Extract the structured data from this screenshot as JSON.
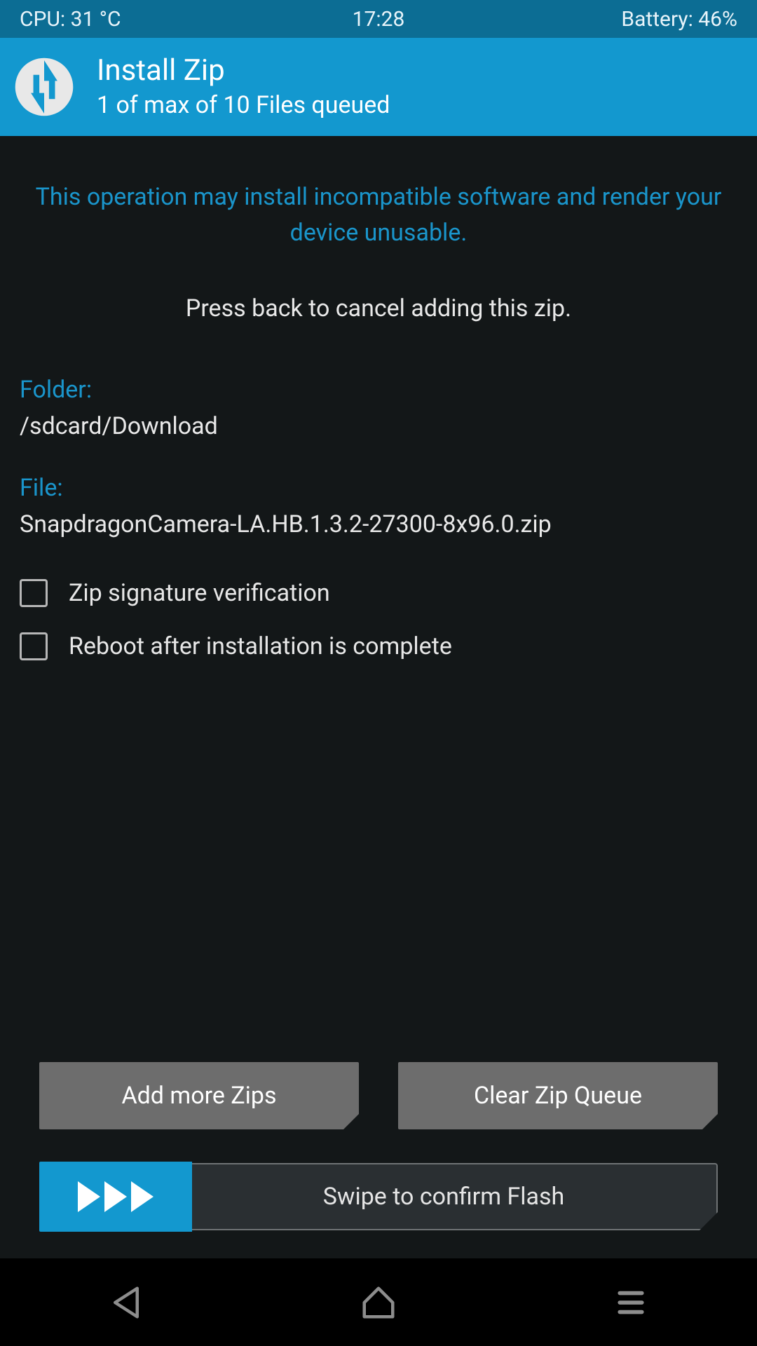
{
  "statusbar": {
    "cpu": "CPU: 31 °C",
    "time": "17:28",
    "battery": "Battery: 46%"
  },
  "header": {
    "title": "Install Zip",
    "subtitle": "1 of max of 10 Files queued"
  },
  "content": {
    "warning": "This operation may install incompatible software and render your device unusable.",
    "instruction": "Press back to cancel adding this zip.",
    "folder_label": "Folder:",
    "folder_value": "/sdcard/Download",
    "file_label": "File:",
    "file_value": "SnapdragonCamera-LA.HB.1.3.2-27300-8x96.0.zip"
  },
  "checkboxes": {
    "zip_sig": "Zip signature verification",
    "reboot": "Reboot after installation is complete"
  },
  "buttons": {
    "add_more": "Add more Zips",
    "clear_queue": "Clear Zip Queue"
  },
  "swipe": {
    "label": "Swipe to confirm Flash"
  }
}
